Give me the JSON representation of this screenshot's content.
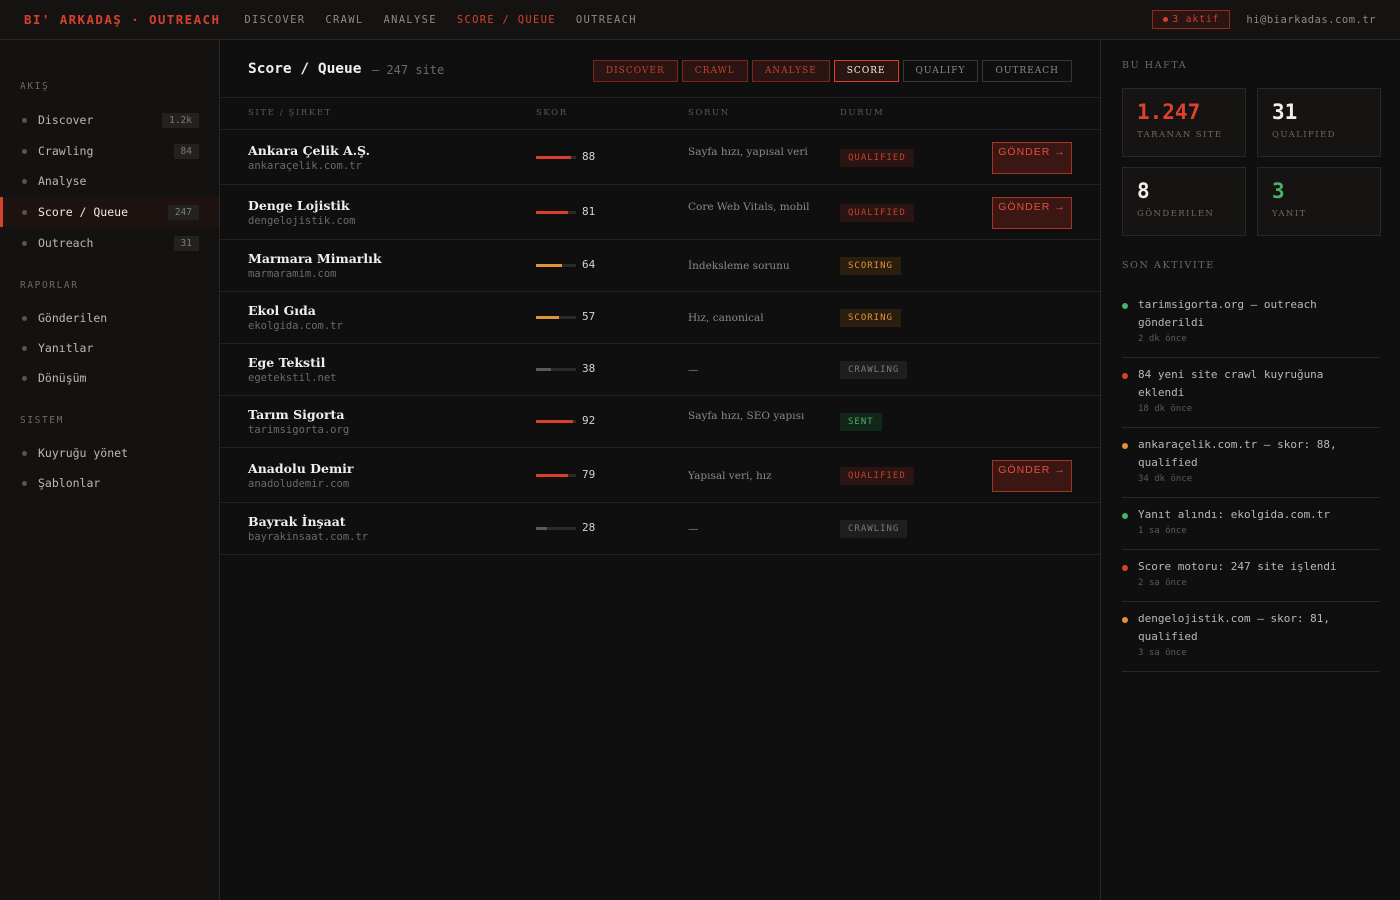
{
  "brand": "BI' ARKADAŞ · OUTREACH",
  "topnav": [
    "DISCOVER",
    "CRAWL",
    "ANALYSE",
    "SCORE / QUEUE",
    "OUTREACH"
  ],
  "topnav_active": "SCORE / QUEUE",
  "active_badge": "3 aktif",
  "email": "hi@biarkadas.com.tr",
  "sidebar": {
    "sections": [
      {
        "title": "AKIŞ",
        "items": [
          {
            "label": "Discover",
            "count": "1.2k"
          },
          {
            "label": "Crawling",
            "count": "84"
          },
          {
            "label": "Analyse",
            "count": ""
          },
          {
            "label": "Score / Queue",
            "count": "247",
            "active": true
          },
          {
            "label": "Outreach",
            "count": "31"
          }
        ]
      },
      {
        "title": "RAPORLAR",
        "items": [
          {
            "label": "Gönderilen",
            "count": ""
          },
          {
            "label": "Yanıtlar",
            "count": ""
          },
          {
            "label": "Dönüşüm",
            "count": ""
          }
        ]
      },
      {
        "title": "SISTEM",
        "items": [
          {
            "label": "Kuyruğu yönet",
            "count": ""
          },
          {
            "label": "Şablonlar",
            "count": ""
          }
        ]
      }
    ]
  },
  "main": {
    "title": "Score / Queue",
    "subtitle": "— 247 site",
    "pipeline": [
      {
        "label": "DISCOVER",
        "state": "done"
      },
      {
        "label": "CRAWL",
        "state": "done"
      },
      {
        "label": "ANALYSE",
        "state": "done"
      },
      {
        "label": "SCORE",
        "state": "current"
      },
      {
        "label": "QUALIFY",
        "state": "todo"
      },
      {
        "label": "OUTREACH",
        "state": "todo"
      }
    ],
    "columns": [
      "SITE / ŞIRKET",
      "SKOR",
      "SORUN",
      "DURUM"
    ],
    "rows": [
      {
        "name": "Ankara Çelik A.Ş.",
        "domain": "ankaraçelik.com.tr",
        "score": "88",
        "score_level": "high",
        "issue": "Sayfa hızı, yapısal veri",
        "status": "QUALIFIED",
        "status_kind": "qualified",
        "action": "GÖNDER →"
      },
      {
        "name": "Denge Lojistik",
        "domain": "dengelojistik.com",
        "score": "81",
        "score_level": "high",
        "issue": "Core Web Vitals, mobil",
        "status": "QUALIFIED",
        "status_kind": "qualified",
        "action": "GÖNDER →"
      },
      {
        "name": "Marmara Mimarlık",
        "domain": "marmaramim.com",
        "score": "64",
        "score_level": "mid",
        "issue": "İndeksleme sorunu",
        "status": "SCORING",
        "status_kind": "scoring",
        "action": ""
      },
      {
        "name": "Ekol Gıda",
        "domain": "ekolgida.com.tr",
        "score": "57",
        "score_level": "mid",
        "issue": "Hız, canonical",
        "status": "SCORING",
        "status_kind": "scoring",
        "action": ""
      },
      {
        "name": "Ege Tekstil",
        "domain": "egetekstil.net",
        "score": "38",
        "score_level": "low",
        "issue": "—",
        "status": "CRAWLING",
        "status_kind": "crawling",
        "action": ""
      },
      {
        "name": "Tarım Sigorta",
        "domain": "tarimsigorta.org",
        "score": "92",
        "score_level": "high",
        "issue": "Sayfa hızı, SEO yapısı",
        "status": "SENT",
        "status_kind": "sent",
        "action": ""
      },
      {
        "name": "Anadolu Demir",
        "domain": "anadoludemir.com",
        "score": "79",
        "score_level": "high",
        "issue": "Yapısal veri, hız",
        "status": "QUALIFIED",
        "status_kind": "qualified",
        "action": "GÖNDER →"
      },
      {
        "name": "Bayrak İnşaat",
        "domain": "bayrakinsaat.com.tr",
        "score": "28",
        "score_level": "low",
        "issue": "—",
        "status": "CRAWLING",
        "status_kind": "crawling",
        "action": ""
      }
    ]
  },
  "right": {
    "week_title": "BU HAFTA",
    "stats": [
      {
        "value": "1.247",
        "label": "TARANAN SITE",
        "color": "red"
      },
      {
        "value": "31",
        "label": "QUALIFIED",
        "color": "white"
      },
      {
        "value": "8",
        "label": "GÖNDERILEN",
        "color": "white"
      },
      {
        "value": "3",
        "label": "YANIT",
        "color": "green"
      }
    ],
    "activity_title": "SON AKTIVITE",
    "activity": [
      {
        "text": "tarimsigorta.org — outreach gönderildi",
        "time": "2 dk önce",
        "color": "green"
      },
      {
        "text": "84 yeni site crawl kuyruğuna eklendi",
        "time": "18 dk önce",
        "color": "red"
      },
      {
        "text": "ankaraçelik.com.tr — skor: 88, qualified",
        "time": "34 dk önce",
        "color": "orange"
      },
      {
        "text": "Yanıt alındı: ekolgida.com.tr",
        "time": "1 sa önce",
        "color": "green"
      },
      {
        "text": "Score motoru: 247 site işlendi",
        "time": "2 sa önce",
        "color": "red"
      },
      {
        "text": "dengelojistik.com — skor: 81, qualified",
        "time": "3 sa önce",
        "color": "orange"
      }
    ]
  },
  "colors": {
    "accent": "#d6402d",
    "bar_high": "#d6402d",
    "bar_mid": "#e0943a",
    "bar_low": "#5e5a55",
    "dot_red": "#d6402d",
    "dot_green": "#4caf6a",
    "dot_orange": "#e0943a"
  }
}
